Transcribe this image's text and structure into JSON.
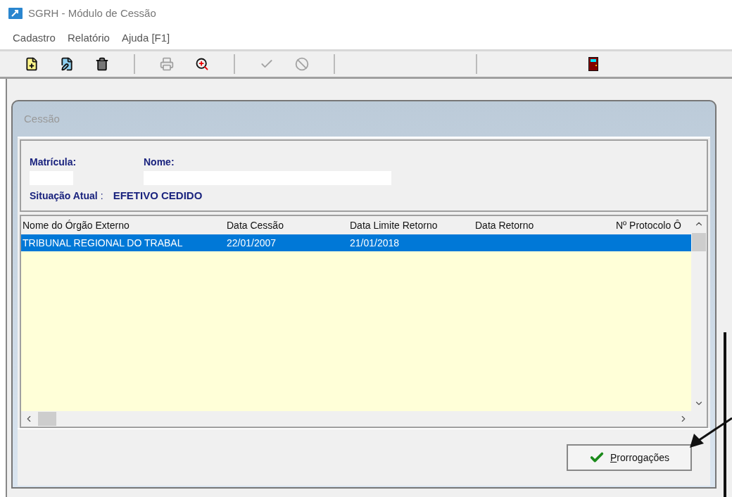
{
  "window": {
    "title": "SGRH - Módulo de Cessão"
  },
  "menu": [
    "Cadastro",
    "Relatório",
    "Ajuda [F1]"
  ],
  "toolbar": [
    {
      "kind": "new",
      "disabled": false
    },
    {
      "kind": "edit",
      "disabled": false
    },
    {
      "kind": "delete",
      "disabled": false
    },
    {
      "kind": "separator"
    },
    {
      "kind": "print",
      "disabled": true
    },
    {
      "kind": "search",
      "disabled": false
    },
    {
      "kind": "separator"
    },
    {
      "kind": "confirm",
      "disabled": true
    },
    {
      "kind": "cancel",
      "disabled": true
    },
    {
      "kind": "separator"
    },
    {
      "kind": "spacer"
    },
    {
      "kind": "separator"
    },
    {
      "kind": "spacer"
    },
    {
      "kind": "exit",
      "disabled": false
    }
  ],
  "dialog": {
    "title": "Cessão",
    "info": {
      "matricula_label": "Matrícula:",
      "nome_label": "Nome:",
      "situacao_label": "Situação Atual",
      "situacao_colon": ":",
      "situacao_value": "EFETIVO CEDIDO"
    },
    "table": {
      "columns": [
        "Nome do Órgão Externo",
        "Data Cessão",
        "Data Limite Retorno",
        "Data Retorno",
        "Nº Protocolo Ô"
      ],
      "rows": [
        {
          "selected": true,
          "cells": [
            "TRIBUNAL REGIONAL DO TRABAL",
            "22/01/2007",
            "21/01/2018"
          ]
        }
      ]
    },
    "button": "Prorrogações"
  }
}
